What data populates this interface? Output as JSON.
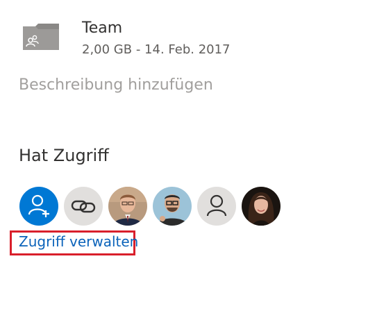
{
  "file": {
    "name": "Team",
    "meta": "2,00 GB - 14. Feb. 2017",
    "icon": "shared-folder-icon"
  },
  "description": {
    "placeholder": "Beschreibung hinzufügen"
  },
  "access": {
    "heading": "Hat Zugriff",
    "avatars": [
      {
        "kind": "add-people",
        "icon": "add-person-icon",
        "color": "#0078d4"
      },
      {
        "kind": "link",
        "icon": "link-icon",
        "color": "#e1dfdd"
      },
      {
        "kind": "person-photo"
      },
      {
        "kind": "person-photo"
      },
      {
        "kind": "generic-person",
        "icon": "person-icon",
        "color": "#e1dfdd"
      },
      {
        "kind": "person-photo"
      }
    ],
    "manage_label": "Zugriff verwalten"
  },
  "colors": {
    "accent": "#0078d4",
    "link": "#0b63ba",
    "highlight": "#d91f2b"
  }
}
